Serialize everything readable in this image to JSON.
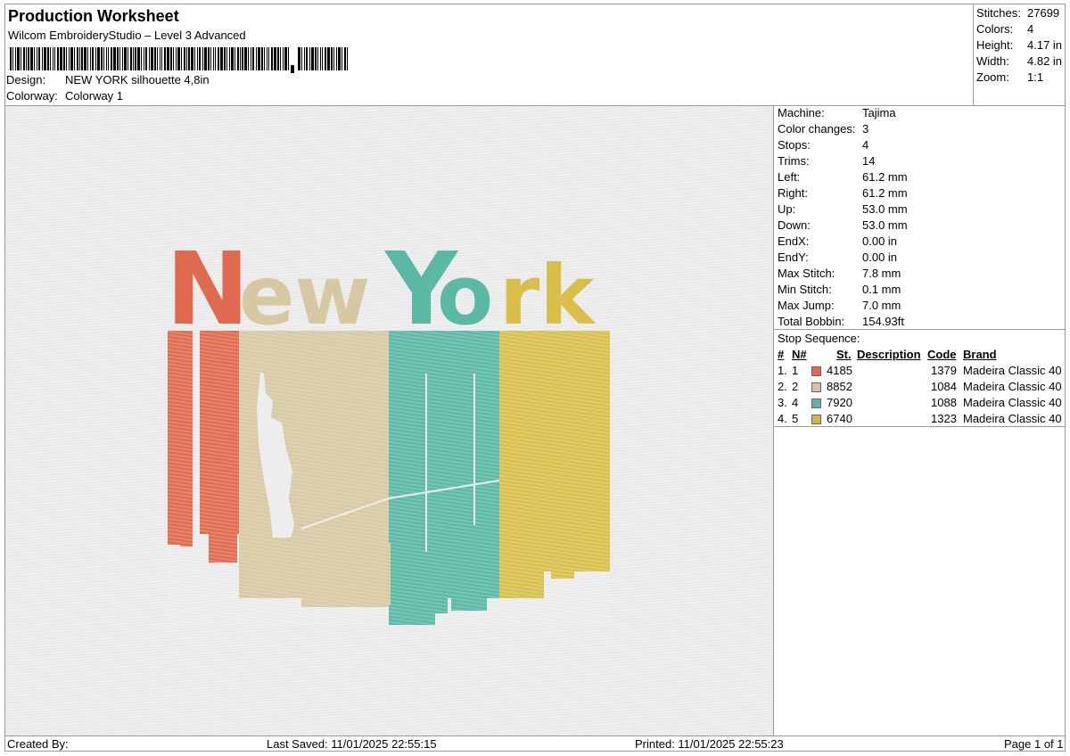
{
  "header": {
    "title": "Production Worksheet",
    "software": "Wilcom EmbroideryStudio – Level 3 Advanced",
    "design_label": "Design:",
    "design_value": "NEW YORK silhouette 4,8in",
    "colorway_label": "Colorway:",
    "colorway_value": "Colorway 1"
  },
  "stats": [
    {
      "label": "Stitches:",
      "value": "27699"
    },
    {
      "label": "Colors:",
      "value": "4"
    },
    {
      "label": "Height:",
      "value": "4.17 in"
    },
    {
      "label": "Width:",
      "value": "4.82 in"
    },
    {
      "label": "Zoom:",
      "value": "1:1"
    }
  ],
  "machine_info": [
    {
      "label": "Machine:",
      "value": "Tajima"
    },
    {
      "label": "Color changes:",
      "value": "3"
    },
    {
      "label": "Stops:",
      "value": "4"
    },
    {
      "label": "Trims:",
      "value": "14"
    },
    {
      "label": "Left:",
      "value": "61.2 mm"
    },
    {
      "label": "Right:",
      "value": "61.2 mm"
    },
    {
      "label": "Up:",
      "value": "53.0 mm"
    },
    {
      "label": "Down:",
      "value": "53.0 mm"
    },
    {
      "label": "EndX:",
      "value": "0.00 in"
    },
    {
      "label": "EndY:",
      "value": "0.00 in"
    },
    {
      "label": "Max Stitch:",
      "value": "7.8 mm"
    },
    {
      "label": "Min Stitch:",
      "value": "0.1 mm"
    },
    {
      "label": "Max Jump:",
      "value": "7.0 mm"
    },
    {
      "label": "Total Bobbin:",
      "value": "154.93ft"
    }
  ],
  "stop_sequence": {
    "title": "Stop Sequence:",
    "headers": {
      "hash": "#",
      "n": "N#",
      "st": "St.",
      "description": "Description",
      "code": "Code",
      "brand": "Brand"
    },
    "rows": [
      {
        "idx": "1.",
        "n": "1",
        "st": "4185",
        "description": "",
        "code": "1379",
        "brand": "Madeira Classic 40",
        "color": "#e06a52"
      },
      {
        "idx": "2.",
        "n": "2",
        "st": "8852",
        "description": "",
        "code": "1084",
        "brand": "Madeira Classic 40",
        "color": "#d8c2a8"
      },
      {
        "idx": "3.",
        "n": "4",
        "st": "7920",
        "description": "",
        "code": "1088",
        "brand": "Madeira Classic 40",
        "color": "#5fb0ac"
      },
      {
        "idx": "4.",
        "n": "5",
        "st": "6740",
        "description": "",
        "code": "1323",
        "brand": "Madeira Classic 40",
        "color": "#d7b24a"
      }
    ]
  },
  "preview": {
    "text_new": "New",
    "text_york": "York",
    "colors": {
      "orange": "#df6a4f",
      "beige": "#d6c8a2",
      "teal": "#5ab8a4",
      "yellow": "#d8bf4c"
    }
  },
  "footer": {
    "created_by": "Created By:",
    "last_saved": "Last Saved: 11/01/2025 22:55:15",
    "printed": "Printed: 11/01/2025 22:55:23",
    "page": "Page 1 of 1"
  }
}
